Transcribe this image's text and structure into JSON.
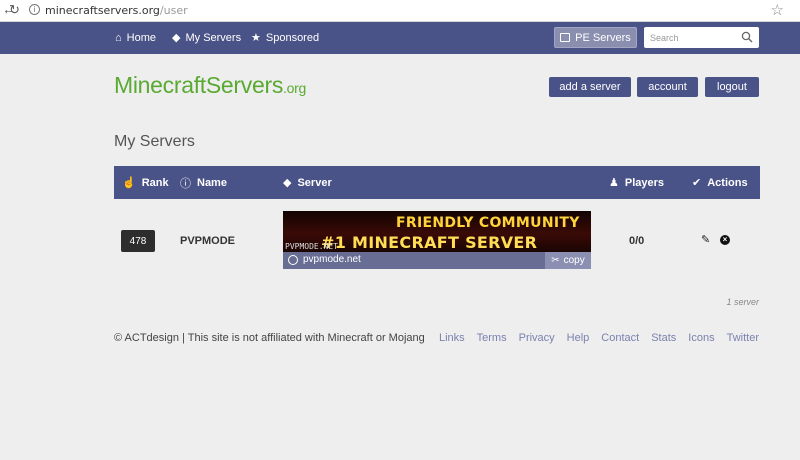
{
  "browser": {
    "url_host": "minecraftservers.org",
    "url_path": "/user"
  },
  "nav": {
    "items": [
      {
        "label": "Home",
        "icon": "home-icon"
      },
      {
        "label": "My Servers",
        "icon": "layers-icon"
      },
      {
        "label": "Sponsored",
        "icon": "star-icon"
      }
    ],
    "pe_button": "PE Servers",
    "search_placeholder": "Search"
  },
  "logo": {
    "main": "MinecraftServers",
    "tld": ".org",
    "color": "#5aaa32"
  },
  "account_buttons": {
    "add_server": "add a server",
    "account": "account",
    "logout": "logout"
  },
  "page_title": "My Servers",
  "table": {
    "headers": {
      "rank": "Rank",
      "name": "Name",
      "server": "Server",
      "players": "Players",
      "actions": "Actions"
    },
    "rows": [
      {
        "rank": "478",
        "name": "PVPMODE",
        "banner_line1": "FRIENDLY COMMUNITY",
        "banner_line2": "#1 MINECRAFT SERVER",
        "banner_line3": "PVPMODE.NET",
        "ip": "pvpmode.net",
        "copy_label": "copy",
        "players": "0/0"
      }
    ],
    "count_text": "1 server"
  },
  "footer": {
    "notice": "© ACTdesign | This site is not affiliated with Minecraft or Mojang",
    "links": [
      "Links",
      "Terms",
      "Privacy",
      "Help",
      "Contact",
      "Stats",
      "Icons",
      "Twitter"
    ]
  },
  "colors": {
    "nav_bg": "#4a5387",
    "page_bg": "#eeeeef",
    "link": "#7b82ad"
  }
}
